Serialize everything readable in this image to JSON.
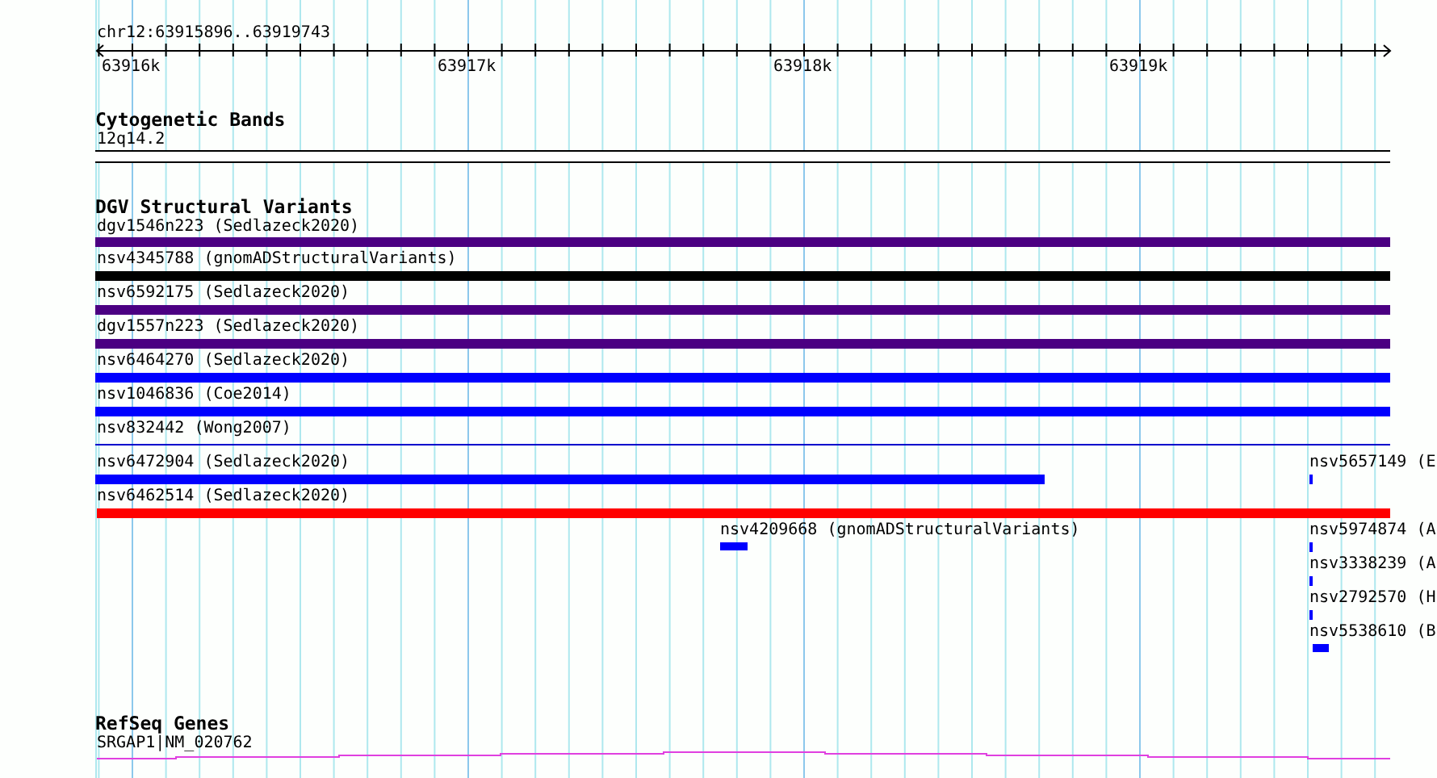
{
  "ruler": {
    "locus": "chr12:63915896..63919743",
    "ticks": [
      "63916k",
      "63917k",
      "63918k",
      "63919k"
    ]
  },
  "tracks": [
    {
      "title": "Cytogenetic Bands",
      "features": [
        {
          "label": "12q14.2",
          "kind": "band"
        }
      ]
    },
    {
      "title": "DGV Structural Variants",
      "features": [
        {
          "label": "dgv1546n223 (Sedlazeck2020)",
          "kind": "bar",
          "color": "#4b0082"
        },
        {
          "label": "nsv4345788 (gnomADStructuralVariants)",
          "kind": "bar",
          "color": "#000000"
        },
        {
          "label": "nsv6592175 (Sedlazeck2020)",
          "kind": "bar",
          "color": "#4b0082"
        },
        {
          "label": "dgv1557n223 (Sedlazeck2020)",
          "kind": "bar",
          "color": "#4b0082"
        },
        {
          "label": "nsv6464270 (Sedlazeck2020)",
          "kind": "bar",
          "color": "#0000ff"
        },
        {
          "label": "nsv1046836 (Coe2014)",
          "kind": "bar",
          "color": "#0000ff"
        },
        {
          "label": "nsv832442 (Wong2007)",
          "kind": "line",
          "color": "#0000cd"
        },
        {
          "label": "nsv6472904 (Sedlazeck2020)",
          "kind": "bar",
          "color": "#0000ff"
        },
        {
          "label": "nsv5657149 (E",
          "kind": "bar",
          "color": "#0000ff"
        },
        {
          "label": "nsv6462514 (Sedlazeck2020)",
          "kind": "bar",
          "color": "#ff0000"
        },
        {
          "label": "nsv4209668 (gnomADStructuralVariants)",
          "kind": "bar",
          "color": "#0000ff"
        },
        {
          "label": "nsv5974874 (A",
          "kind": "bar",
          "color": "#0000ff"
        },
        {
          "label": "nsv3338239 (A",
          "kind": "bar",
          "color": "#0000ff"
        },
        {
          "label": "nsv2792570 (H",
          "kind": "bar",
          "color": "#0000ff"
        },
        {
          "label": "nsv5538610 (B",
          "kind": "bar",
          "color": "#0000ff"
        }
      ]
    },
    {
      "title": "RefSeq Genes",
      "features": [
        {
          "label": "SRGAP1|NM_020762",
          "kind": "gene"
        }
      ]
    }
  ]
}
